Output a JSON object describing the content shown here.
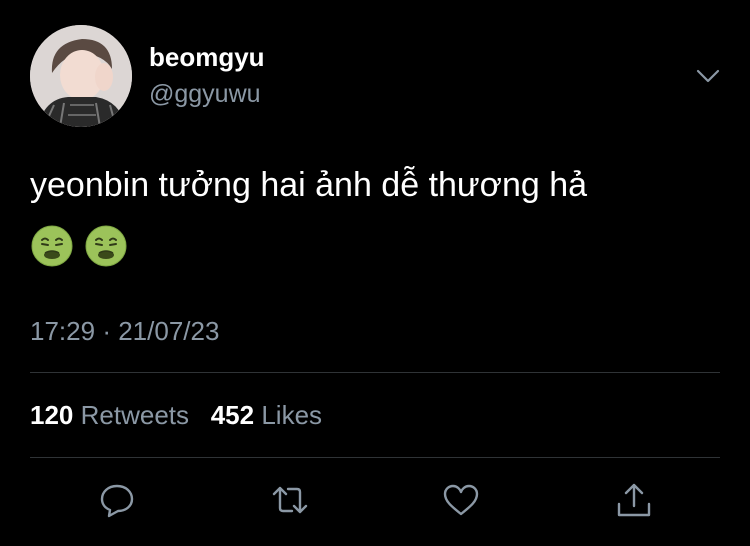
{
  "user": {
    "display_name": "beomgyu",
    "handle": "@ggyuwu"
  },
  "tweet": {
    "text": "yeonbin tưởng hai ảnh dễ thương hả",
    "emojis": [
      "nauseated-face-icon",
      "nauseated-face-icon"
    ],
    "time": "17:29",
    "separator": "·",
    "date": "21/07/23"
  },
  "stats": {
    "retweets_count": "120",
    "retweets_label": "Retweets",
    "likes_count": "452",
    "likes_label": "Likes"
  },
  "actions": [
    "reply-icon",
    "retweet-icon",
    "like-icon",
    "share-icon"
  ],
  "colors": {
    "background": "#000000",
    "text_primary": "#ffffff",
    "text_secondary": "#8b98a5",
    "divider": "#2f3336"
  }
}
